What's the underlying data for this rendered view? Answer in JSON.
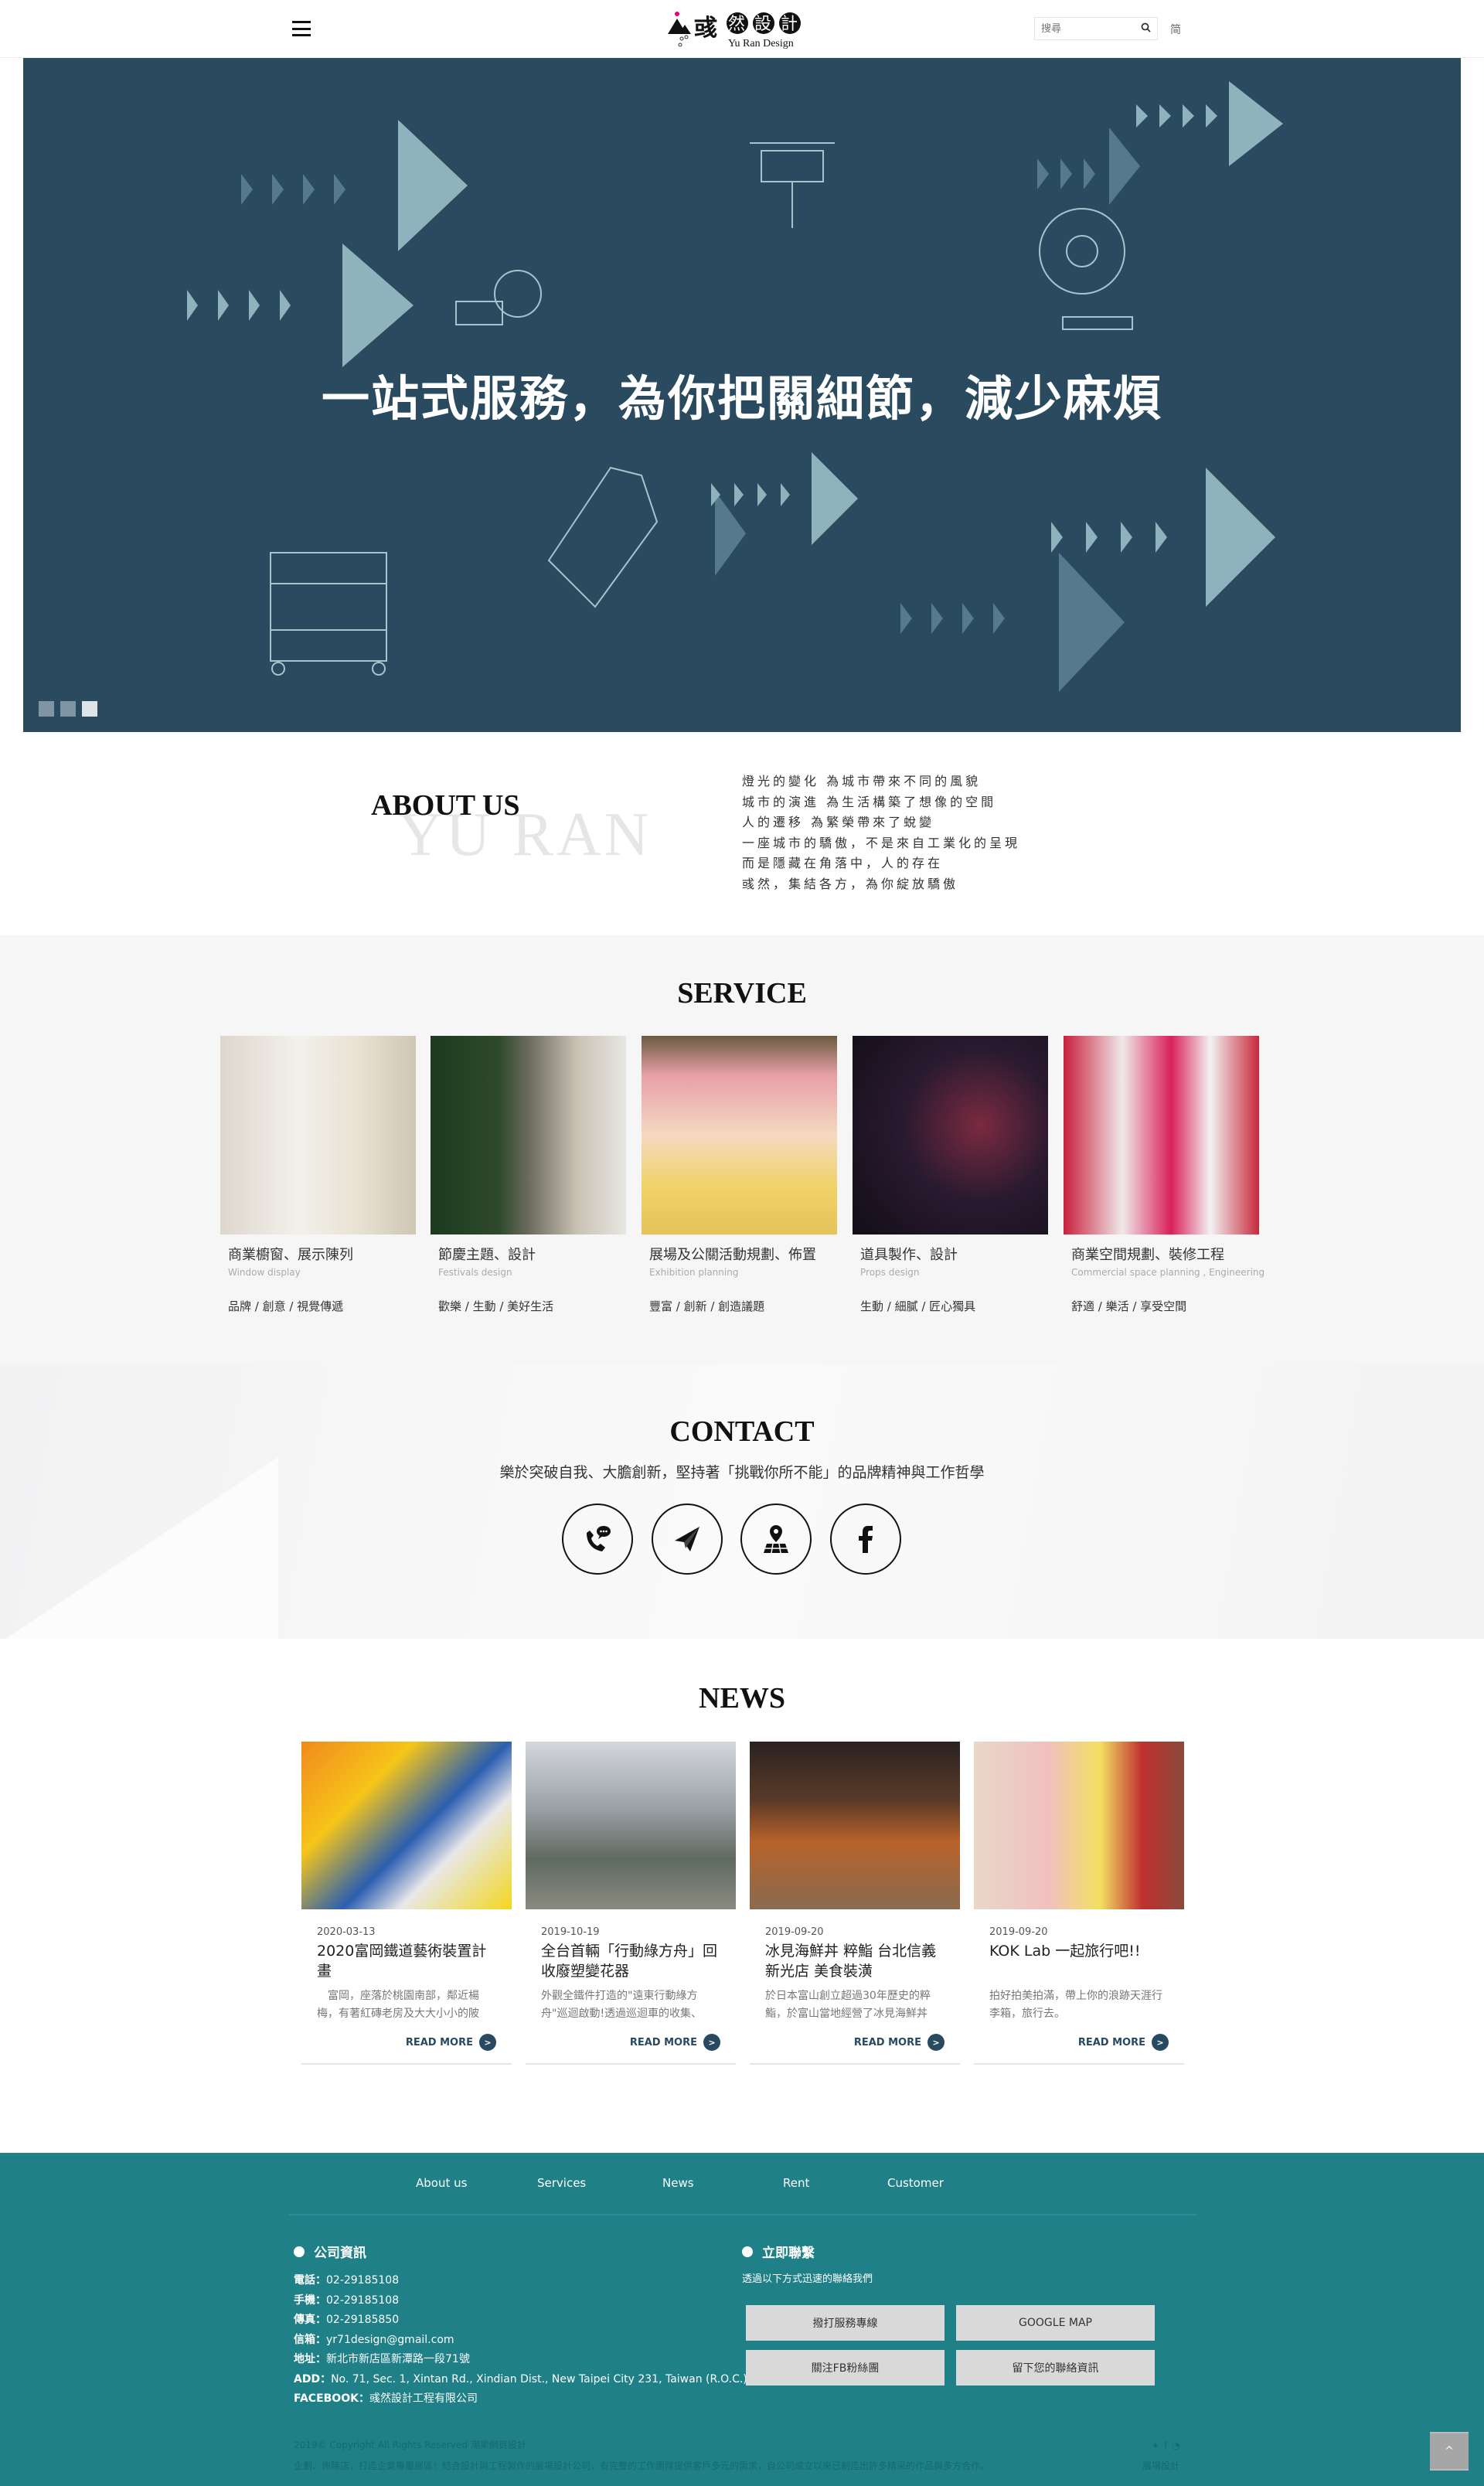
{
  "header": {
    "logo_text": "彧然設計",
    "logo_sub": "Yu Ran Design",
    "search_placeholder": "搜尋",
    "lang_toggle": "简"
  },
  "hero": {
    "title": "一站式服務，為你把關細節，減少麻煩",
    "slides": 3,
    "active_slide": 3,
    "colors": {
      "background": "#2a4a5f",
      "triangle_light": "#8fb3bc",
      "triangle_mid": "#557a8c"
    }
  },
  "about": {
    "title": "ABOUT US",
    "watermark": "YU RAN",
    "lines": [
      "燈光的變化 為城市帶來不同的風貌",
      "城市的演進 為生活構築了想像的空間",
      "人的遷移 為繁榮帶來了蛻變",
      "一座城市的驕傲，不是來自工業化的呈現",
      "而是隱藏在角落中，人的存在",
      "彧然，集結各方，為你綻放驕傲"
    ]
  },
  "service": {
    "title": "SERVICE",
    "items": [
      {
        "title": "商業櫥窗、展示陳列",
        "subtitle": "Window display",
        "tags": "品牌 / 創意 / 視覺傳遞"
      },
      {
        "title": "節慶主題、設計",
        "subtitle": "Festivals design",
        "tags": "歡樂 / 生動 / 美好生活"
      },
      {
        "title": "展場及公關活動規劃、佈置",
        "subtitle": "Exhibition planning",
        "tags": "豐富 / 創新 / 創造議題"
      },
      {
        "title": "道具製作、設計",
        "subtitle": "Props design",
        "tags": "生動 / 細膩 / 匠心獨具"
      },
      {
        "title": "商業空間規劃、裝修工程",
        "subtitle": "Commercial space planning , Engineering",
        "tags": "舒適 / 樂活 / 享受空間"
      }
    ]
  },
  "contact": {
    "title": "CONTACT",
    "subtitle": "樂於突破自我、大膽創新，堅持著「挑戰你所不能」的品牌精神與工作哲學",
    "icons": [
      "phone-chat-icon",
      "paper-plane-icon",
      "map-pin-icon",
      "facebook-icon"
    ]
  },
  "news": {
    "title": "NEWS",
    "read_more": "READ MORE",
    "items": [
      {
        "date": "2020-03-13",
        "title": "2020富岡鐵道藝術裝置計畫",
        "excerpt": "　富岡，座落於桃園南部，鄰近楊梅，有著紅磚老房及大大小小的陂"
      },
      {
        "date": "2019-10-19",
        "title": "全台首輛「行動綠方舟」回收廢塑變花器",
        "excerpt": "外觀全鐵件打造的\"遠東行動綠方舟\"巡迴啟動!透過巡迴車的收集、"
      },
      {
        "date": "2019-09-20",
        "title": "冰見海鮮丼 粹鮨 台北信義新光店 美食裝潢",
        "excerpt": "於日本富山創立超過30年歷史的粹鮨，於富山當地經營了冰見海鮮丼"
      },
      {
        "date": "2019-09-20",
        "title": "KOK Lab 一起旅行吧!!",
        "excerpt": "拍好拍美拍滿，帶上你的浪跡天涯行李箱，旅行去。"
      }
    ]
  },
  "footer": {
    "nav": [
      "About us",
      "Services",
      "News",
      "Rent",
      "Customer"
    ],
    "company_heading": "公司資訊",
    "company_info": [
      {
        "label": "電話：",
        "value": "02-29185108"
      },
      {
        "label": "手機：",
        "value": "02-29185108"
      },
      {
        "label": "傳真：",
        "value": "02-29185850"
      },
      {
        "label": "信箱：",
        "value": "yr71design@gmail.com"
      },
      {
        "label": "地址：",
        "value": "新北市新店區新潭路一段71號"
      },
      {
        "label": "ADD：",
        "value": "No. 71, Sec. 1, Xintan Rd., Xindian Dist., New Taipei City 231, Taiwan (R.O.C.)"
      },
      {
        "label": "FACEBOOK：",
        "value": "彧然設計工程有限公司"
      }
    ],
    "contact_heading": "立即聯繫",
    "contact_sub": "透過以下方式迅速的聯絡我們",
    "buttons": [
      "撥打服務專線",
      "GOOGLE MAP",
      "關注FB粉絲團",
      "留下您的聯絡資訊"
    ],
    "copyright": "2019© Copyright All Rights Reserved 潮果網頁設計",
    "description": "企劃、佈陳店，打造企業專屬展區！結合設計與工程製作的展場設計公司，有完整的工作團隊提供客戶多元的需求，自公司成立以來已創造出許多精采的作品與多方合作。",
    "side_text": "展場設計",
    "social_icons": [
      "twitter-icon",
      "facebook-icon",
      "rss-icon"
    ],
    "scroll_top": "^",
    "color": "#1f8088"
  }
}
